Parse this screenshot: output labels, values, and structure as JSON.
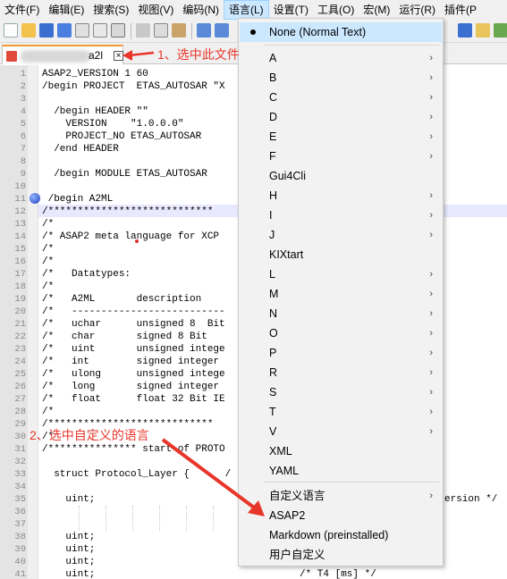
{
  "menubar": [
    {
      "label": "文件(F)"
    },
    {
      "label": "编辑(E)"
    },
    {
      "label": "搜索(S)"
    },
    {
      "label": "视图(V)"
    },
    {
      "label": "编码(N)"
    },
    {
      "label": "语言(L)"
    },
    {
      "label": "设置(T)"
    },
    {
      "label": "工具(O)"
    },
    {
      "label": "宏(M)"
    },
    {
      "label": "运行(R)"
    },
    {
      "label": "插件(P"
    }
  ],
  "tab": {
    "label": "a2l",
    "close": "×"
  },
  "editor": {
    "line_numbers": [
      "1",
      "2",
      "3",
      "4",
      "5",
      "6",
      "7",
      "8",
      "9",
      "10",
      "11",
      "12",
      "13",
      "14",
      "15",
      "16",
      "17",
      "18",
      "19",
      "20",
      "21",
      "22",
      "23",
      "24",
      "25",
      "26",
      "27",
      "28",
      "29",
      "30",
      "31",
      "32",
      "33",
      "34",
      "35",
      "36",
      "37",
      "38",
      "39",
      "40",
      "41"
    ],
    "lines": [
      "ASAP2_VERSION 1 60",
      "/begin PROJECT  ETAS_AUTOSAR \"X",
      "",
      "  /begin HEADER \"\"",
      "    VERSION    \"1.0.0.0\"",
      "    PROJECT_NO ETAS_AUTOSAR",
      "  /end HEADER",
      "",
      "  /begin MODULE ETAS_AUTOSAR",
      "",
      " /begin A2ML",
      "/****************************",
      "/*",
      "/* ASAP2 meta language for XCP ",
      "/*",
      "/*",
      "/*   Datatypes:",
      "/*",
      "/*   A2ML       description",
      "/*   --------------------------",
      "/*   uchar      unsigned 8  Bit",
      "/*   char       signed 8 Bit",
      "/*   uint       unsigned intege",
      "/*   int        signed integer",
      "/*   ulong      unsigned intege",
      "/*   long       signed integer",
      "/*   float      float 32 Bit IE",
      "/*",
      "/****************************",
      "/*",
      "/*************** start of PROTO",
      "",
      "  struct Protocol_Layer {      /",
      "",
      "    uint;",
      "",
      "",
      "    uint;",
      "    uint;",
      "    uint;",
      "    uint;"
    ],
    "line35_tail": "ersion */",
    "line41_tail": "/* T4 [ms] */"
  },
  "annotations": {
    "step1": "1、选中此文件",
    "step2": "2、选中自定义的语言"
  },
  "language_menu": {
    "items": [
      {
        "label": "None (Normal Text)",
        "submenu": false,
        "selected": true
      },
      {
        "label": "A",
        "submenu": true
      },
      {
        "label": "B",
        "submenu": true
      },
      {
        "label": "C",
        "submenu": true
      },
      {
        "label": "D",
        "submenu": true
      },
      {
        "label": "E",
        "submenu": true
      },
      {
        "label": "F",
        "submenu": true
      },
      {
        "label": "Gui4Cli",
        "submenu": false
      },
      {
        "label": "H",
        "submenu": true
      },
      {
        "label": "I",
        "submenu": true
      },
      {
        "label": "J",
        "submenu": true
      },
      {
        "label": "KIXtart",
        "submenu": false
      },
      {
        "label": "L",
        "submenu": true
      },
      {
        "label": "M",
        "submenu": true
      },
      {
        "label": "N",
        "submenu": true
      },
      {
        "label": "O",
        "submenu": true
      },
      {
        "label": "P",
        "submenu": true
      },
      {
        "label": "R",
        "submenu": true
      },
      {
        "label": "S",
        "submenu": true
      },
      {
        "label": "T",
        "submenu": true
      },
      {
        "label": "V",
        "submenu": true
      },
      {
        "label": "XML",
        "submenu": false
      },
      {
        "label": "YAML",
        "submenu": false
      },
      {
        "label": "自定义语言",
        "submenu": true
      },
      {
        "label": "ASAP2",
        "submenu": false
      },
      {
        "label": "Markdown (preinstalled)",
        "submenu": false
      },
      {
        "label": "用户自定义",
        "submenu": false
      }
    ],
    "submenu_arrow": "›"
  },
  "colors": {
    "annotation": "#e8352a",
    "menu_highlight": "#cce8ff",
    "tab_accent": "#f39c34"
  }
}
